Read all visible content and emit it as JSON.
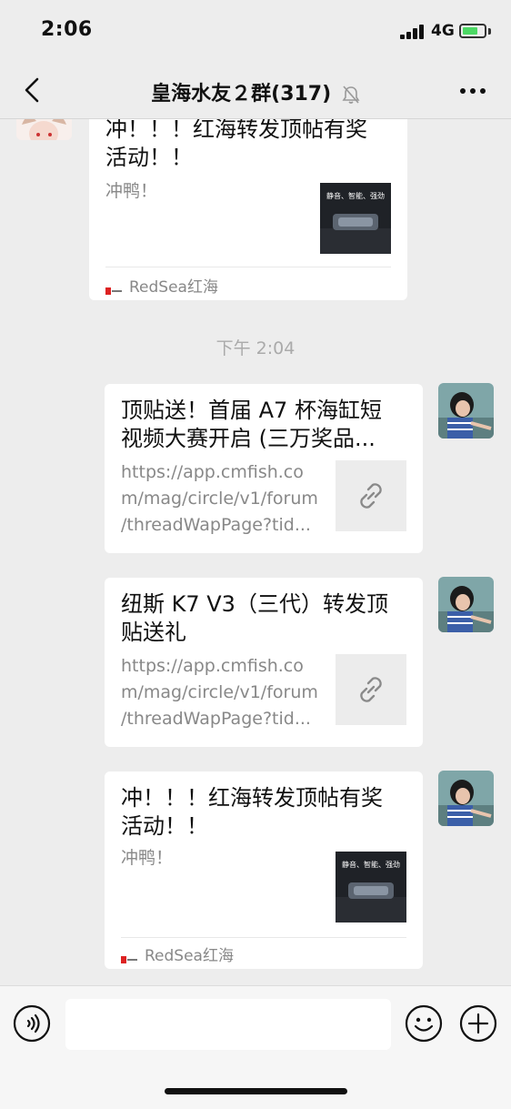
{
  "status_bar": {
    "time": "2:06",
    "network": "4G"
  },
  "header": {
    "title": "皇海水友２群(317)"
  },
  "chat": {
    "timestamp": "下午 2:04",
    "messages": [
      {
        "sender": "other",
        "title_lines": [
          "冲！！！红海转发顶帖有奖",
          "活动！！"
        ],
        "desc": "冲鸭！",
        "thumb_text": "静音、智能、强劲",
        "source": "RedSea红海"
      },
      {
        "sender": "self",
        "title_lines": [
          "顶贴送！首届 A7 杯海缸短",
          "视频大赛开启 (三万奖品..."
        ],
        "desc_lines": [
          "https://app.cmfish.co",
          "m/mag/circle/v1/forum",
          "/threadWapPage?tid..."
        ]
      },
      {
        "sender": "self",
        "title_lines": [
          "纽斯 K7 V3（三代）转发顶",
          "贴送礼"
        ],
        "desc_lines": [
          "https://app.cmfish.co",
          "m/mag/circle/v1/forum",
          "/threadWapPage?tid..."
        ]
      },
      {
        "sender": "self",
        "title_lines": [
          "冲！！！红海转发顶帖有奖",
          "活动！！"
        ],
        "desc": "冲鸭！",
        "thumb_text": "静音、智能、强劲",
        "source": "RedSea红海"
      }
    ]
  },
  "colors": {
    "background": "#ededed",
    "card": "#ffffff",
    "link_gray": "#888888",
    "battery": "#4cd964"
  },
  "icons": [
    "back-icon",
    "mute-icon",
    "more-icon",
    "link-icon",
    "voice-icon",
    "emoji-icon",
    "plus-icon"
  ]
}
